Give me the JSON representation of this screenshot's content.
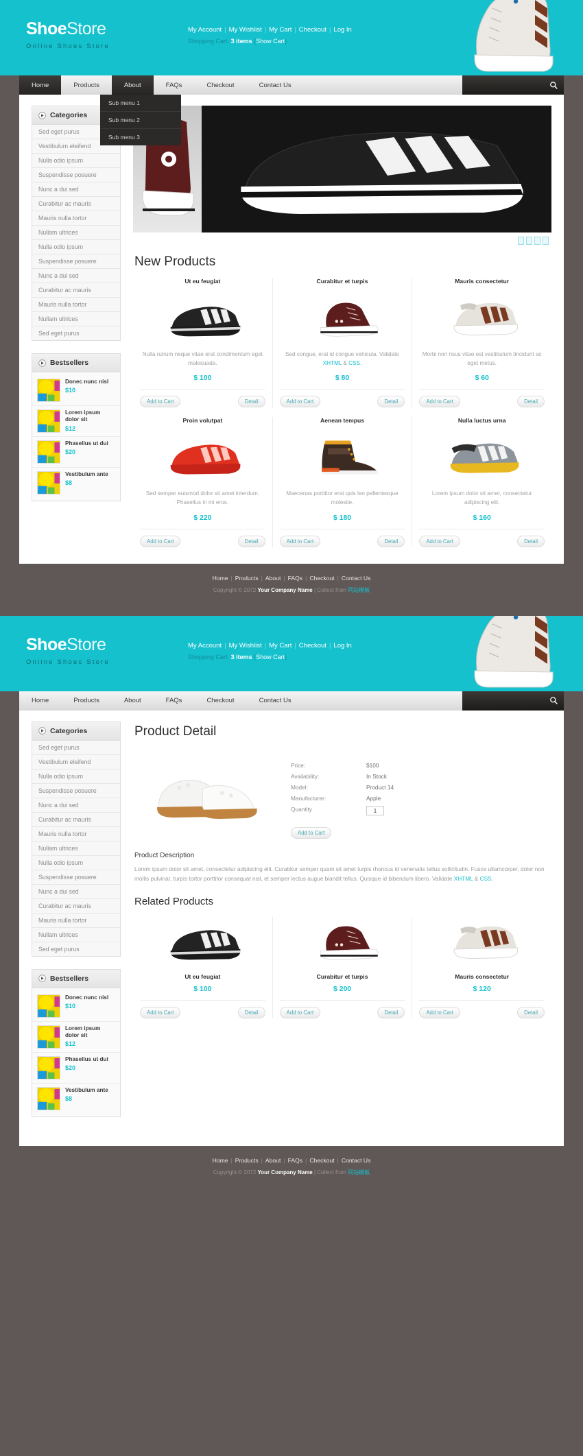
{
  "header": {
    "logo_bold": "Shoe",
    "logo_light": "Store",
    "tagline": "Online Shoes Store",
    "top_links": [
      "My Account",
      "My Wishlist",
      "My Cart",
      "Checkout",
      "Log In"
    ],
    "cart_label": "Shopping Cart:",
    "cart_count": "3 items",
    "cart_open": "(",
    "cart_show": "Show Cart",
    "cart_close": ")"
  },
  "nav": {
    "items": [
      {
        "label": "Home",
        "style": "dark"
      },
      {
        "label": "Products",
        "style": "light"
      },
      {
        "label": "About",
        "style": "dark"
      },
      {
        "label": "FAQs",
        "style": "light"
      },
      {
        "label": "Checkout",
        "style": "light"
      },
      {
        "label": "Contact Us",
        "style": "light"
      }
    ],
    "submenu": [
      "Sub menu 1",
      "Sub menu 2",
      "Sub menu 3"
    ],
    "search_placeholder": ""
  },
  "sidebar": {
    "categories_title": "Categories",
    "categories": [
      "Sed eget purus",
      "Vestibulum eleifend",
      "Nulla odio ipsum",
      "Suspendisse posuere",
      "Nunc a dui sed",
      "Curabitur ac mauris",
      "Mauris nulla tortor",
      "Nullam ultrices",
      "Nulla odio ipsum",
      "Suspendisse posuere",
      "Nunc a dui sed",
      "Curabitur ac mauris",
      "Mauris nulla tortor",
      "Nullam ultrices",
      "Sed eget purus"
    ],
    "bestsellers_title": "Bestsellers",
    "bestsellers": [
      {
        "title": "Donec nunc nisl",
        "price": "$10"
      },
      {
        "title": "Lorem ipsum dolor sit",
        "price": "$12"
      },
      {
        "title": "Phasellus ut dui",
        "price": "$20"
      },
      {
        "title": "Vestibulum ante",
        "price": "$8"
      }
    ]
  },
  "home": {
    "section_title": "New Products",
    "products": [
      {
        "name": "Ut eu feugiat",
        "desc": "Nulla rutrum neque vitae erat condimentum eget malesuada.",
        "price": "$ 100",
        "add": "Add to Cart",
        "detail": "Detail",
        "shoe": "black-sneaker"
      },
      {
        "name": "Curabitur et turpis",
        "desc_pre": "Sed congue, erat id congue vehicula. Validate ",
        "link1": "XHTML",
        "desc_mid": " & ",
        "link2": "CSS",
        "desc_post": ".",
        "price": "$ 80",
        "add": "Add to Cart",
        "detail": "Detail",
        "shoe": "maroon-hightop"
      },
      {
        "name": "Mauris consectetur",
        "desc": "Morbi non risus vitae est vestibulum tincidunt ac eget metus.",
        "price": "$ 60",
        "add": "Add to Cart",
        "detail": "Detail",
        "shoe": "cream-sneaker"
      },
      {
        "name": "Proin volutpat",
        "desc": "Sed semper euismod dolor sit amet interdum. Phasellus in mi eros.",
        "price": "$ 220",
        "add": "Add to Cart",
        "detail": "Detail",
        "shoe": "red-sneaker"
      },
      {
        "name": "Aenean tempus",
        "desc": "Maecenas porttitor erat quis leo pellentesque molestie.",
        "price": "$ 180",
        "add": "Add to Cart",
        "detail": "Detail",
        "shoe": "brown-boot"
      },
      {
        "name": "Nulla luctus urna",
        "desc": "Lorem ipsum dolor sit amet, consectetur adipiscing elit.",
        "price": "$ 160",
        "add": "Add to Cart",
        "detail": "Detail",
        "shoe": "grey-sneaker"
      }
    ]
  },
  "detail": {
    "page_title": "Product Detail",
    "fields": [
      {
        "key": "Price:",
        "value": "$100"
      },
      {
        "key": "Availability:",
        "value": "In Stock"
      },
      {
        "key": "Model:",
        "value": "Product 14"
      },
      {
        "key": "Manufacturer:",
        "value": "Apple"
      },
      {
        "key": "Quantity",
        "value": "1"
      }
    ],
    "add_to_cart": "Add to Cart",
    "desc_heading": "Product Description",
    "desc_pre": "Lorem ipsum dolor sit amet, consectetur adipiscing elit. Curabitur semper quam sit amet turpis rhoncus id venenatis tellus sollicitudin. Fusce ullamcorper, dolor non mollis pulvinar, turpis tortor porttitor consequat nisl, et semper lectus augue blandit tellus. Quisque id bibendum libero. Validate ",
    "link1": "XHTML",
    "desc_mid": " & ",
    "link2": "CSS",
    "desc_post": ".",
    "related_title": "Related Products",
    "related": [
      {
        "name": "Ut eu feugiat",
        "price": "$ 100",
        "add": "Add to Cart",
        "detail": "Detail",
        "shoe": "black-sneaker"
      },
      {
        "name": "Curabitur et turpis",
        "price": "$ 200",
        "add": "Add to Cart",
        "detail": "Detail",
        "shoe": "maroon-hightop"
      },
      {
        "name": "Mauris consectetur",
        "price": "$ 120",
        "add": "Add to Cart",
        "detail": "Detail",
        "shoe": "cream-sneaker"
      }
    ]
  },
  "footer": {
    "links": [
      "Home",
      "Products",
      "About",
      "FAQs",
      "Checkout",
      "Contact Us"
    ],
    "copy_pre": "Copyright © 2072 ",
    "company": "Your Company Name",
    "copy_mid": " | Collect from ",
    "collect_link": "同站模板"
  },
  "colors": {
    "teal": "#16c1ce",
    "dark_nav": "#2c2a29",
    "page_bg": "#5f5856"
  }
}
